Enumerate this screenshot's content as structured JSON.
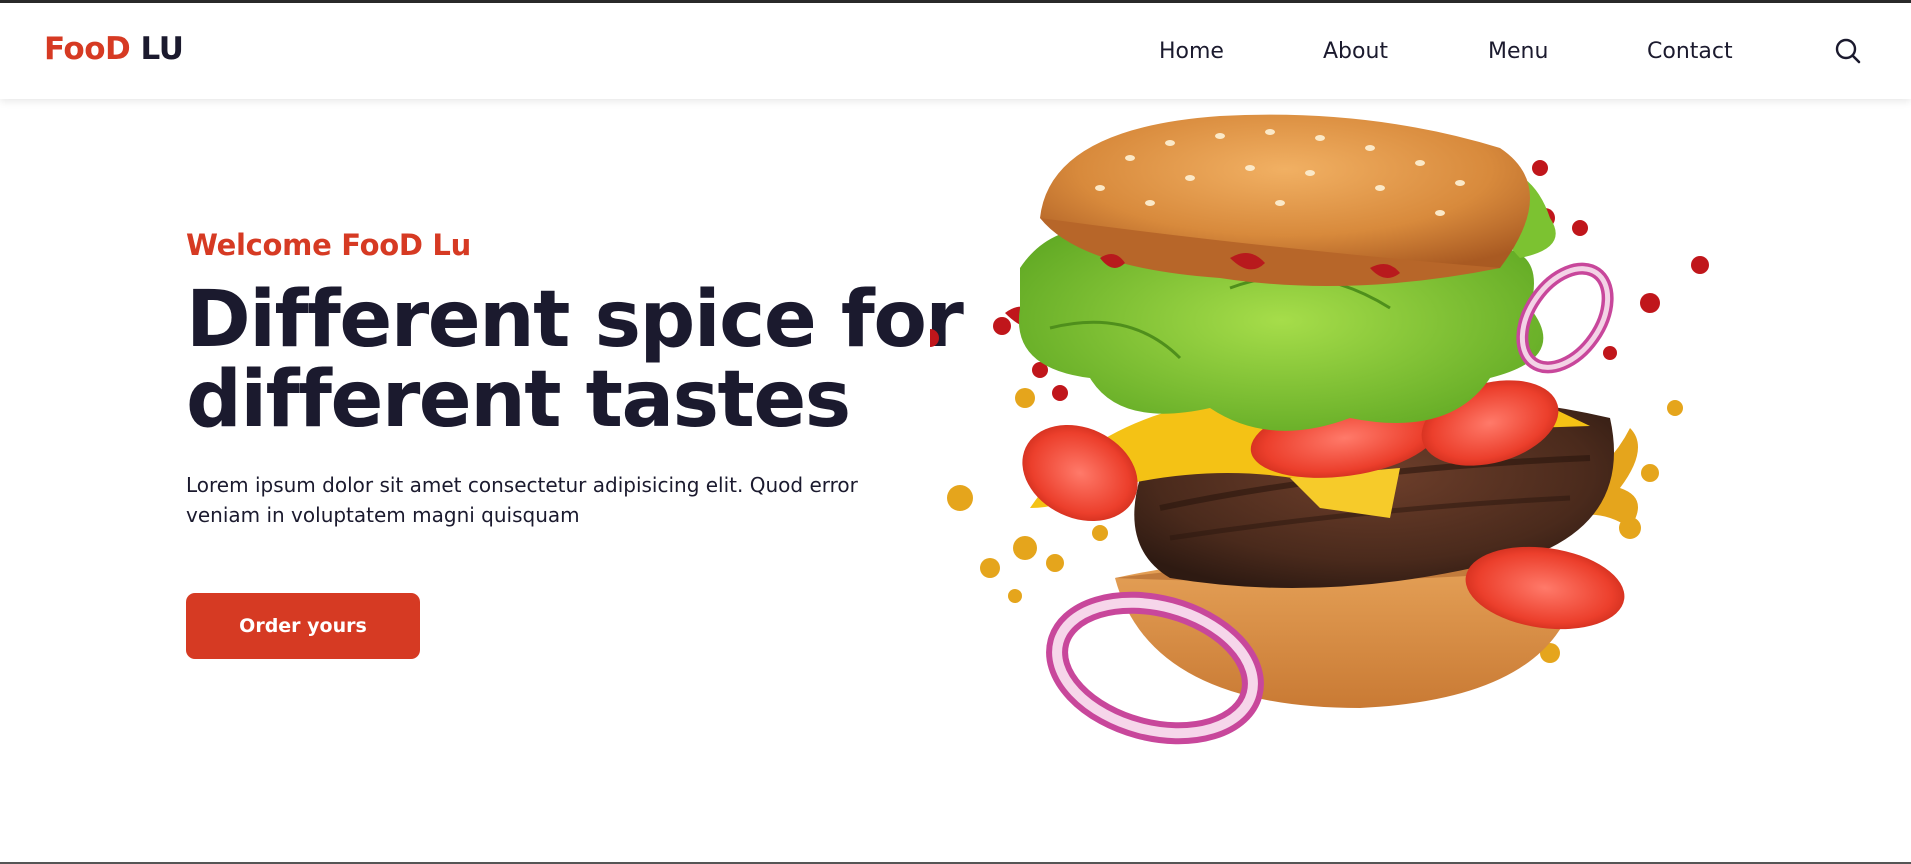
{
  "logo": {
    "part1": "Foo",
    "part2": "D",
    "part3": " LU"
  },
  "nav": {
    "items": [
      {
        "label": "Home"
      },
      {
        "label": "About"
      },
      {
        "label": "Menu"
      },
      {
        "label": "Contact"
      }
    ]
  },
  "icons": {
    "search": "search-icon"
  },
  "hero": {
    "welcome": "Welcome FooD Lu",
    "headline_line1": "Different spice for",
    "headline_line2": "different tastes",
    "description_line1": "Lorem ipsum dolor sit amet consectetur adipisicing elit. Quod error",
    "description_line2": "veniam in voluptatem magni quisquam",
    "button": "Order yours"
  },
  "colors": {
    "accent": "#d63a23",
    "text": "#1b1a2e",
    "background": "#ffffff"
  }
}
